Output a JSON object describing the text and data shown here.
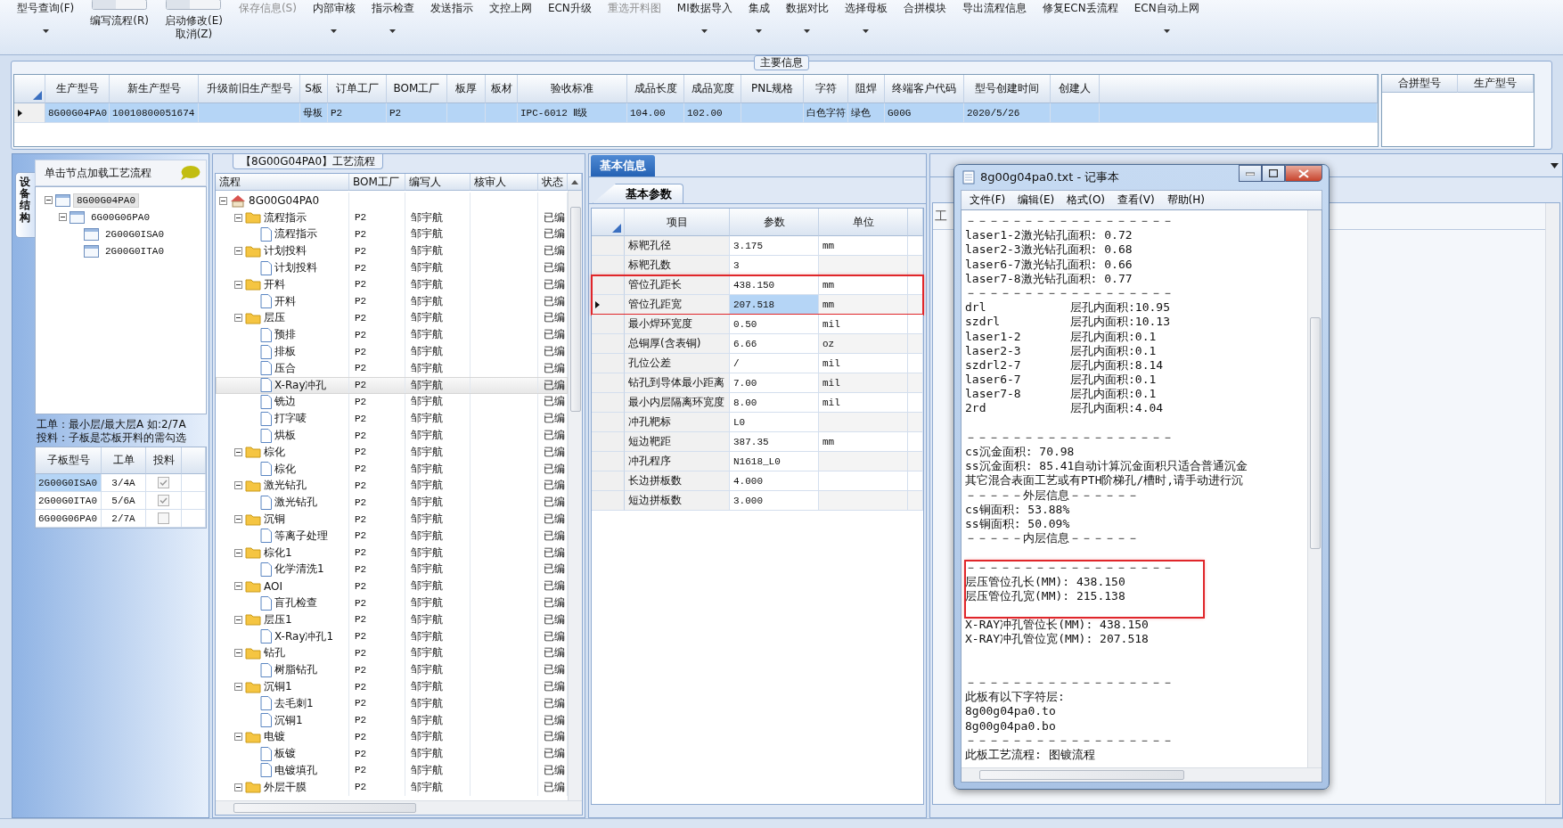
{
  "toolbar": [
    {
      "kind": "button",
      "label": "型号查询(F)",
      "caret": true,
      "disabled": false
    },
    {
      "kind": "toggle",
      "label": "编写流程(R)",
      "caret": false,
      "disabled": false
    },
    {
      "kind": "toggle",
      "label": "启动修改(E)",
      "label2": "取消(Z)",
      "caret": false,
      "disabled": false
    },
    {
      "kind": "button",
      "label": "保存信息(S)",
      "caret": false,
      "disabled": true
    },
    {
      "kind": "button",
      "label": "内部审核",
      "caret": true,
      "disabled": false
    },
    {
      "kind": "button",
      "label": "指示检查",
      "caret": true,
      "disabled": false
    },
    {
      "kind": "button",
      "label": "发送指示",
      "caret": false,
      "disabled": false
    },
    {
      "kind": "button",
      "label": "文控上网",
      "caret": false,
      "disabled": false
    },
    {
      "kind": "button",
      "label": "ECN升级",
      "caret": false,
      "disabled": false
    },
    {
      "kind": "button",
      "label": "重选开料图",
      "caret": false,
      "disabled": true
    },
    {
      "kind": "button",
      "label": "MI数据导入",
      "caret": true,
      "disabled": false
    },
    {
      "kind": "button",
      "label": "集成",
      "caret": true,
      "disabled": false
    },
    {
      "kind": "button",
      "label": "数据对比",
      "caret": true,
      "disabled": false
    },
    {
      "kind": "button",
      "label": "选择母板",
      "caret": true,
      "disabled": false
    },
    {
      "kind": "button",
      "label": "合拼模块",
      "caret": false,
      "disabled": false
    },
    {
      "kind": "button",
      "label": "导出流程信息",
      "caret": false,
      "disabled": false
    },
    {
      "kind": "button",
      "label": "修复ECN丢流程",
      "caret": false,
      "disabled": false
    },
    {
      "kind": "button",
      "label": "ECN自动上网",
      "caret": true,
      "disabled": false
    }
  ],
  "main_info": {
    "title": "主要信息",
    "columns": [
      "生产型号",
      "新生产型号",
      "升级前旧生产型号",
      "S板",
      "订单工厂",
      "BOM工厂",
      "板厚",
      "板材",
      "验收标准",
      "成品长度",
      "成品宽度",
      "PNL规格",
      "字符",
      "阻焊",
      "终端客户代码",
      "型号创建时间",
      "创建人"
    ],
    "rows": [
      {
        "selected": true,
        "cells": [
          "8G00G04PA0",
          "10010800051674",
          null,
          "母板",
          "P2",
          "P2",
          null,
          null,
          "IPC-6012 Ⅱ级",
          "104.00",
          "102.00",
          null,
          "白色字符",
          "绿色",
          "G00G",
          "2020/5/26",
          null
        ]
      }
    ],
    "merge_columns": [
      "合拼型号",
      "生产型号"
    ]
  },
  "left_panel": {
    "side_tab": "设备结构",
    "hint": "单击节点加载工艺流程",
    "tree": [
      {
        "label": "8G00G04PA0",
        "selected": true,
        "expanded": true,
        "children": [
          {
            "label": "6G00G06PA0",
            "selected": false,
            "expanded": true,
            "children": [
              {
                "label": "2G00G0ISA0",
                "selected": false
              },
              {
                "label": "2G00G0ITA0",
                "selected": false
              }
            ]
          }
        ]
      }
    ],
    "notes": [
      "工单：最小层/最大层A 如:2/7A",
      "投料：子板是芯板开料的需勾选"
    ],
    "sub_boards": {
      "columns": [
        "子板型号",
        "工单",
        "投料"
      ],
      "rows": [
        {
          "model": "2G00G0ISA0",
          "order": "3/4A",
          "feed": true,
          "selected": true
        },
        {
          "model": "2G00G0ITA0",
          "order": "5/6A",
          "feed": true,
          "selected": false
        },
        {
          "model": "6G00G06PA0",
          "order": "2/7A",
          "feed": false,
          "selected": false
        }
      ]
    }
  },
  "flow": {
    "title": "【8G00G04PA0】工艺流程",
    "columns": [
      "流程",
      "BOM工厂",
      "编写人",
      "核审人",
      "状态"
    ],
    "tree": [
      {
        "kind": "root",
        "label": "8G00G04PA0",
        "selected": false,
        "expanded": true,
        "children": [
          {
            "kind": "folder",
            "label": "流程指示",
            "bom": "P2",
            "writer": "邹宇航",
            "status": "已编",
            "selected": false,
            "expanded": true,
            "children": [
              {
                "kind": "doc",
                "label": "流程指示",
                "bom": "P2",
                "writer": "邹宇航",
                "status": "已编",
                "selected": false
              }
            ]
          },
          {
            "kind": "folder",
            "label": "计划投料",
            "bom": "P2",
            "writer": "邹宇航",
            "status": "已编",
            "selected": false,
            "expanded": true,
            "children": [
              {
                "kind": "doc",
                "label": "计划投料",
                "bom": "P2",
                "writer": "邹宇航",
                "status": "已编",
                "selected": false
              }
            ]
          },
          {
            "kind": "folder",
            "label": "开料",
            "bom": "P2",
            "writer": "邹宇航",
            "status": "已编",
            "selected": false,
            "expanded": true,
            "children": [
              {
                "kind": "doc",
                "label": "开料",
                "bom": "P2",
                "writer": "邹宇航",
                "status": "已编",
                "selected": false
              }
            ]
          },
          {
            "kind": "folder",
            "label": "层压",
            "bom": "P2",
            "writer": "邹宇航",
            "status": "已编",
            "selected": false,
            "expanded": true,
            "children": [
              {
                "kind": "doc",
                "label": "预排",
                "bom": "P2",
                "writer": "邹宇航",
                "status": "已编",
                "selected": false
              },
              {
                "kind": "doc",
                "label": "排板",
                "bom": "P2",
                "writer": "邹宇航",
                "status": "已编",
                "selected": false
              },
              {
                "kind": "doc",
                "label": "压合",
                "bom": "P2",
                "writer": "邹宇航",
                "status": "已编",
                "selected": false
              },
              {
                "kind": "doc",
                "label": "X-Ray冲孔",
                "bom": "P2",
                "writer": "邹宇航",
                "status": "已编",
                "selected": true
              },
              {
                "kind": "doc",
                "label": "铣边",
                "bom": "P2",
                "writer": "邹宇航",
                "status": "已编",
                "selected": false
              },
              {
                "kind": "doc",
                "label": "打字唛",
                "bom": "P2",
                "writer": "邹宇航",
                "status": "已编",
                "selected": false
              },
              {
                "kind": "doc",
                "label": "烘板",
                "bom": "P2",
                "writer": "邹宇航",
                "status": "已编",
                "selected": false
              }
            ]
          },
          {
            "kind": "folder",
            "label": "棕化",
            "bom": "P2",
            "writer": "邹宇航",
            "status": "已编",
            "selected": false,
            "expanded": true,
            "children": [
              {
                "kind": "doc",
                "label": "棕化",
                "bom": "P2",
                "writer": "邹宇航",
                "status": "已编",
                "selected": false
              }
            ]
          },
          {
            "kind": "folder",
            "label": "激光钻孔",
            "bom": "P2",
            "writer": "邹宇航",
            "status": "已编",
            "selected": false,
            "expanded": true,
            "children": [
              {
                "kind": "doc",
                "label": "激光钻孔",
                "bom": "P2",
                "writer": "邹宇航",
                "status": "已编",
                "selected": false
              }
            ]
          },
          {
            "kind": "folder",
            "label": "沉铜",
            "bom": "P2",
            "writer": "邹宇航",
            "status": "已编",
            "selected": false,
            "expanded": true,
            "children": [
              {
                "kind": "doc",
                "label": "等离子处理",
                "bom": "P2",
                "writer": "邹宇航",
                "status": "已编",
                "selected": false
              }
            ]
          },
          {
            "kind": "folder",
            "label": "棕化1",
            "bom": "P2",
            "writer": "邹宇航",
            "status": "已编",
            "selected": false,
            "expanded": true,
            "children": [
              {
                "kind": "doc",
                "label": "化学清洗1",
                "bom": "P2",
                "writer": "邹宇航",
                "status": "已编",
                "selected": false
              }
            ]
          },
          {
            "kind": "folder",
            "label": "AOI",
            "bom": "P2",
            "writer": "邹宇航",
            "status": "已编",
            "selected": false,
            "expanded": true,
            "children": [
              {
                "kind": "doc",
                "label": "盲孔检查",
                "bom": "P2",
                "writer": "邹宇航",
                "status": "已编",
                "selected": false
              }
            ]
          },
          {
            "kind": "folder",
            "label": "层压1",
            "bom": "P2",
            "writer": "邹宇航",
            "status": "已编",
            "selected": false,
            "expanded": true,
            "children": [
              {
                "kind": "doc",
                "label": "X-Ray冲孔1",
                "bom": "P2",
                "writer": "邹宇航",
                "status": "已编",
                "selected": false
              }
            ]
          },
          {
            "kind": "folder",
            "label": "钻孔",
            "bom": "P2",
            "writer": "邹宇航",
            "status": "已编",
            "selected": false,
            "expanded": true,
            "children": [
              {
                "kind": "doc",
                "label": "树脂钻孔",
                "bom": "P2",
                "writer": "邹宇航",
                "status": "已编",
                "selected": false
              }
            ]
          },
          {
            "kind": "folder",
            "label": "沉铜1",
            "bom": "P2",
            "writer": "邹宇航",
            "status": "已编",
            "selected": false,
            "expanded": true,
            "children": [
              {
                "kind": "doc",
                "label": "去毛刺1",
                "bom": "P2",
                "writer": "邹宇航",
                "status": "已编",
                "selected": false
              },
              {
                "kind": "doc",
                "label": "沉铜1",
                "bom": "P2",
                "writer": "邹宇航",
                "status": "已编",
                "selected": false
              }
            ]
          },
          {
            "kind": "folder",
            "label": "电镀",
            "bom": "P2",
            "writer": "邹宇航",
            "status": "已编",
            "selected": false,
            "expanded": true,
            "children": [
              {
                "kind": "doc",
                "label": "板镀",
                "bom": "P2",
                "writer": "邹宇航",
                "status": "已编",
                "selected": false
              },
              {
                "kind": "doc",
                "label": "电镀填孔",
                "bom": "P2",
                "writer": "邹宇航",
                "status": "已编",
                "selected": false
              }
            ]
          },
          {
            "kind": "folder",
            "label": "外层干膜",
            "bom": "P2",
            "writer": "邹宇航",
            "status": "已编",
            "selected": false,
            "expanded": true
          }
        ]
      }
    ]
  },
  "params": {
    "tabs": [
      {
        "label": "基本信息",
        "selected": true
      }
    ],
    "subtab": "基本参数",
    "columns": [
      "项目",
      "参数",
      "单位"
    ],
    "rows": [
      {
        "item": "标靶孔径",
        "value": "3.175",
        "unit": "mm",
        "selected": false,
        "boxed": false
      },
      {
        "item": "标靶孔数",
        "value": "3",
        "selected": false,
        "boxed": false
      },
      {
        "item": "管位孔距长",
        "value": "438.150",
        "unit": "mm",
        "selected": false,
        "boxed": true
      },
      {
        "item": "管位孔距宽",
        "value": "207.518",
        "unit": "mm",
        "selected": true,
        "boxed": true
      },
      {
        "item": "最小焊环宽度",
        "value": "0.50",
        "unit": "mil",
        "selected": false,
        "boxed": false
      },
      {
        "item": "总铜厚(含表铜)",
        "value": "6.66",
        "unit": "oz",
        "selected": false,
        "boxed": false
      },
      {
        "item": "孔位公差",
        "value": "/",
        "unit": "mil",
        "selected": false,
        "boxed": false
      },
      {
        "item": "钻孔到导体最小距离",
        "value": "7.00",
        "unit": "mil",
        "selected": false,
        "boxed": false
      },
      {
        "item": "最小内层隔离环宽度",
        "value": "8.00",
        "unit": "mil",
        "selected": false,
        "boxed": false
      },
      {
        "item": "冲孔靶标",
        "value": "L0",
        "selected": false,
        "boxed": false
      },
      {
        "item": "短边靶距",
        "value": "387.35",
        "unit": "mm",
        "selected": false,
        "boxed": false
      },
      {
        "item": "冲孔程序",
        "value": "N1618_L0",
        "selected": false,
        "boxed": false
      },
      {
        "item": "长边拼板数",
        "value": "4.000",
        "selected": false,
        "boxed": false
      },
      {
        "item": "短边拼板数",
        "value": "3.000",
        "selected": false,
        "boxed": false
      }
    ]
  },
  "right_panel": {
    "label": "工"
  },
  "notepad": {
    "title": "8g00g04pa0.txt - 记事本",
    "menu": [
      "文件(F)",
      "编辑(E)",
      "格式(O)",
      "查看(V)",
      "帮助(H)"
    ],
    "lines": [
      {
        "kind": "text",
        "text": "－－－－－－－－－－－－－－－－－－",
        "boxed": false
      },
      {
        "kind": "text",
        "text": "laser1-2激光钻孔面积: 0.72",
        "boxed": false
      },
      {
        "kind": "text",
        "text": "laser2-3激光钻孔面积: 0.68",
        "boxed": false
      },
      {
        "kind": "text",
        "text": "laser6-7激光钻孔面积: 0.66",
        "boxed": false
      },
      {
        "kind": "text",
        "text": "laser7-8激光钻孔面积: 0.77",
        "boxed": false
      },
      {
        "kind": "text",
        "text": "－－－－－－－－－－－－－－－－－－",
        "boxed": false
      },
      {
        "kind": "pair",
        "cells": [
          "drl",
          "层孔内面积:10.95"
        ],
        "boxed": false
      },
      {
        "kind": "pair",
        "cells": [
          "szdrl",
          "层孔内面积:10.13"
        ],
        "boxed": false
      },
      {
        "kind": "pair",
        "cells": [
          "laser1-2",
          "层孔内面积:0.1"
        ],
        "boxed": false
      },
      {
        "kind": "pair",
        "cells": [
          "laser2-3",
          "层孔内面积:0.1"
        ],
        "boxed": false
      },
      {
        "kind": "pair",
        "cells": [
          "szdrl2-7",
          "层孔内面积:8.14"
        ],
        "boxed": false
      },
      {
        "kind": "pair",
        "cells": [
          "laser6-7",
          "层孔内面积:0.1"
        ],
        "boxed": false
      },
      {
        "kind": "pair",
        "cells": [
          "laser7-8",
          "层孔内面积:0.1"
        ],
        "boxed": false
      },
      {
        "kind": "pair",
        "cells": [
          "2rd",
          "层孔内面积:4.04"
        ],
        "boxed": false
      },
      {
        "kind": "blank",
        "boxed": false
      },
      {
        "kind": "text",
        "text": "－－－－－－－－－－－－－－－－－－",
        "boxed": false
      },
      {
        "kind": "text",
        "text": "cs沉金面积: 70.98",
        "boxed": false
      },
      {
        "kind": "text",
        "text": "ss沉金面积: 85.41自动计算沉金面积只适合普通沉金",
        "boxed": false
      },
      {
        "kind": "text",
        "text": "其它混合表面工艺或有PTH阶梯孔/槽时,请手动进行沉",
        "boxed": false
      },
      {
        "kind": "text",
        "text": "－－－－－外层信息－－－－－－",
        "boxed": false
      },
      {
        "kind": "text",
        "text": "cs铜面积: 53.88%",
        "boxed": false
      },
      {
        "kind": "text",
        "text": "ss铜面积: 50.09%",
        "boxed": false
      },
      {
        "kind": "text",
        "text": "－－－－－内层信息－－－－－－",
        "boxed": false
      },
      {
        "kind": "blank",
        "boxed": false
      },
      {
        "kind": "text",
        "text": "－－－－－－－－－－－－－－－－－－",
        "boxed": true
      },
      {
        "kind": "text",
        "text": "层压管位孔长(MM): 438.150",
        "boxed": true
      },
      {
        "kind": "text",
        "text": "层压管位孔宽(MM): 215.138",
        "boxed": true
      },
      {
        "kind": "blank",
        "boxed": true
      },
      {
        "kind": "text",
        "text": "X-RAY冲孔管位长(MM): 438.150",
        "boxed": false
      },
      {
        "kind": "text",
        "text": "X-RAY冲孔管位宽(MM): 207.518",
        "boxed": false
      },
      {
        "kind": "blank",
        "boxed": false
      },
      {
        "kind": "blank",
        "boxed": false
      },
      {
        "kind": "text",
        "text": "－－－－－－－－－－－－－－－－－－",
        "boxed": false
      },
      {
        "kind": "text",
        "text": "此板有以下字符层:",
        "boxed": false
      },
      {
        "kind": "text",
        "text": "8g00g04pa0.to",
        "boxed": false
      },
      {
        "kind": "text",
        "text": "8g00g04pa0.bo",
        "boxed": false
      },
      {
        "kind": "text",
        "text": "－－－－－－－－－－－－－－－－－－",
        "boxed": false
      },
      {
        "kind": "text",
        "text": "此板工艺流程: 图镀流程",
        "boxed": false
      }
    ]
  }
}
